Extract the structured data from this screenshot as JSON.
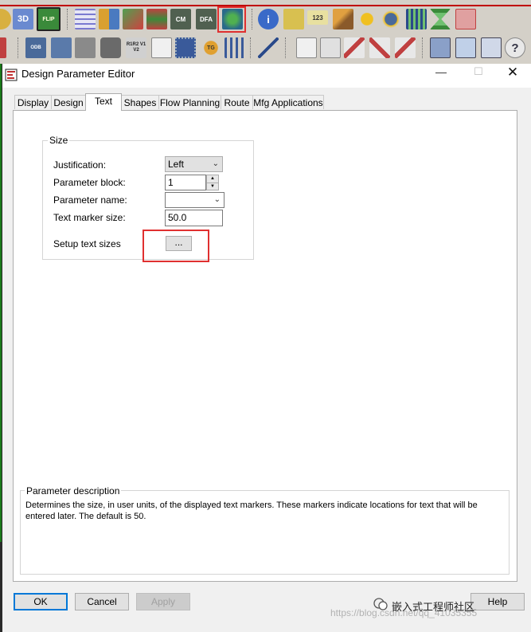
{
  "toolbar": {
    "row1_labels": [
      "3D",
      "FLIP",
      "CM",
      "DFA",
      "123"
    ],
    "row2_labels": [
      "ODB",
      "R1R2 V1 V2",
      "TG"
    ],
    "row1_icons": [
      "circle-icon",
      "3d-icon",
      "flip-icon",
      "grid-icon",
      "components-icon",
      "color-icon",
      "layers-icon",
      "cm-icon",
      "dfa-icon",
      "design-parameter-icon",
      "info-icon",
      "properties-icon",
      "measure-icon",
      "broom-icon",
      "sun-icon",
      "sun-blue-icon",
      "bars-icon",
      "hourglass-icon",
      "cursor-icon"
    ],
    "row2_icons": [
      "arrow-icon",
      "odb-icon",
      "book-icon",
      "pipe-icon",
      "camera-icon",
      "r1r2-icon",
      "page-icon",
      "chip-icon",
      "route-icon",
      "network-icon",
      "wave-icon",
      "doc-icon",
      "book-open-icon",
      "squiggle1-icon",
      "squiggle2-icon",
      "squiggle3-icon",
      "copy-icon",
      "envelope-icon",
      "window-icon",
      "help-icon"
    ]
  },
  "dialog": {
    "title": "Design Parameter Editor",
    "minimize": "—",
    "maximize": "☐",
    "close": "✕"
  },
  "tabs": [
    "Display",
    "Design",
    "Text",
    "Shapes",
    "Flow Planning",
    "Route",
    "Mfg Applications"
  ],
  "active_tab": "Text",
  "size_group": {
    "legend": "Size",
    "justification_label": "Justification:",
    "justification_value": "Left",
    "parameter_block_label": "Parameter block:",
    "parameter_block_value": "1",
    "parameter_name_label": "Parameter name:",
    "parameter_name_value": "",
    "text_marker_size_label": "Text marker size:",
    "text_marker_size_value": "50.0",
    "setup_text_sizes_label": "Setup text sizes",
    "setup_button_label": "..."
  },
  "description": {
    "legend": "Parameter description",
    "text": "Determines the size, in user units, of the displayed text markers. These markers indicate locations for text that will be entered later. The default is 50."
  },
  "buttons": {
    "ok": "OK",
    "cancel": "Cancel",
    "apply": "Apply",
    "help": "Help"
  },
  "watermark": {
    "brand": "嵌入式工程师社区",
    "url": "https://blog.csdn.net/qq_41035355"
  },
  "colors": {
    "highlight": "#e03030",
    "accent": "#0078d7"
  }
}
